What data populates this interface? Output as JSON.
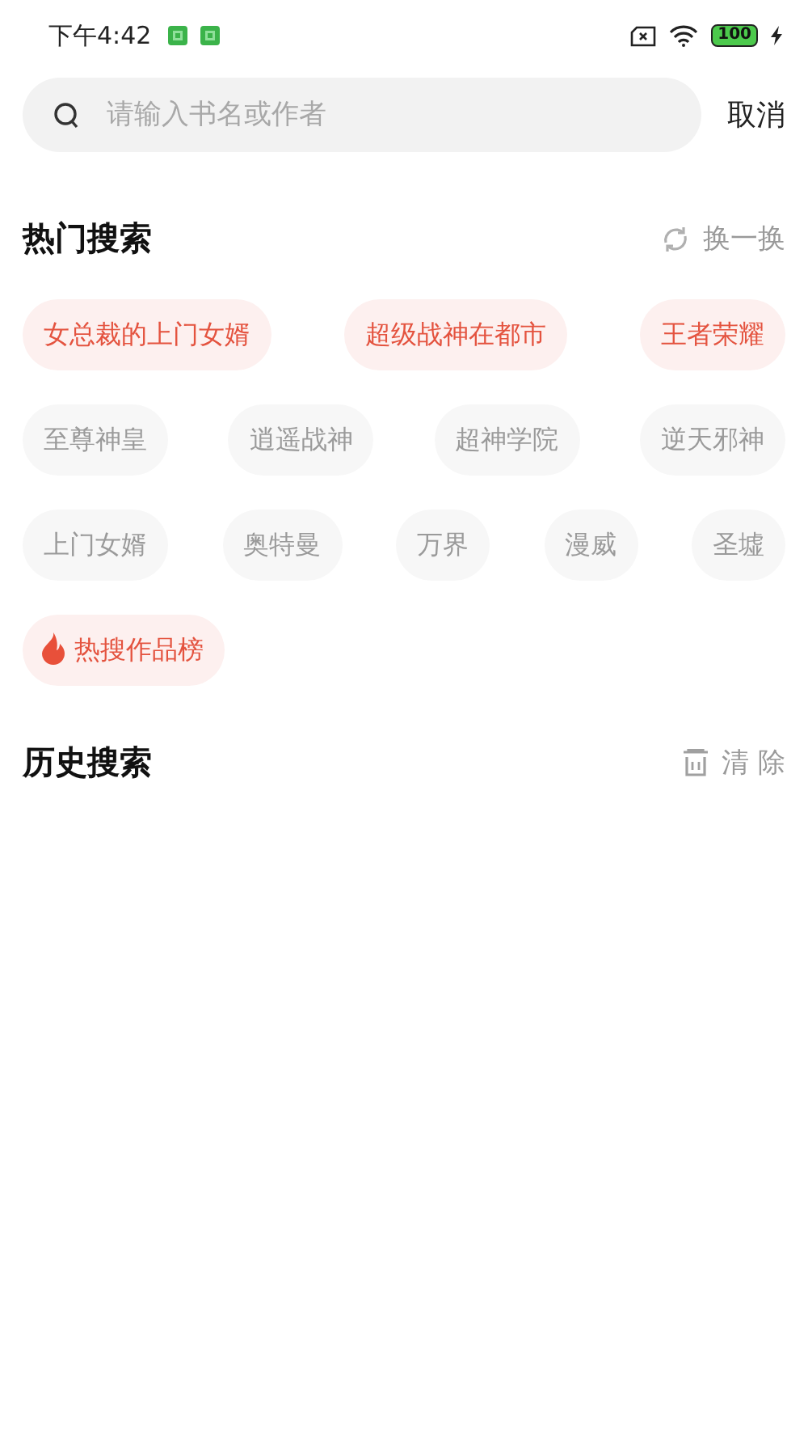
{
  "status_bar": {
    "time": "下午4:42",
    "battery": "100"
  },
  "search": {
    "placeholder": "请输入书名或作者",
    "cancel": "取消"
  },
  "hot_search": {
    "title": "热门搜索",
    "refresh": "换一换",
    "tag_rows": [
      [
        {
          "label": "女总裁的上门女婿",
          "kind": "hot"
        },
        {
          "label": "超级战神在都市",
          "kind": "hot"
        },
        {
          "label": "王者荣耀",
          "kind": "hot"
        }
      ],
      [
        {
          "label": "至尊神皇",
          "kind": "normal"
        },
        {
          "label": "逍遥战神",
          "kind": "normal"
        },
        {
          "label": "超神学院",
          "kind": "normal"
        },
        {
          "label": "逆天邪神",
          "kind": "normal"
        }
      ],
      [
        {
          "label": "上门女婿",
          "kind": "normal"
        },
        {
          "label": "奥特曼",
          "kind": "normal"
        },
        {
          "label": "万界",
          "kind": "normal"
        },
        {
          "label": "漫威",
          "kind": "normal"
        },
        {
          "label": "圣墟",
          "kind": "normal"
        }
      ]
    ],
    "ranking": "热搜作品榜"
  },
  "history": {
    "title": "历史搜索",
    "clear": "清 除"
  }
}
